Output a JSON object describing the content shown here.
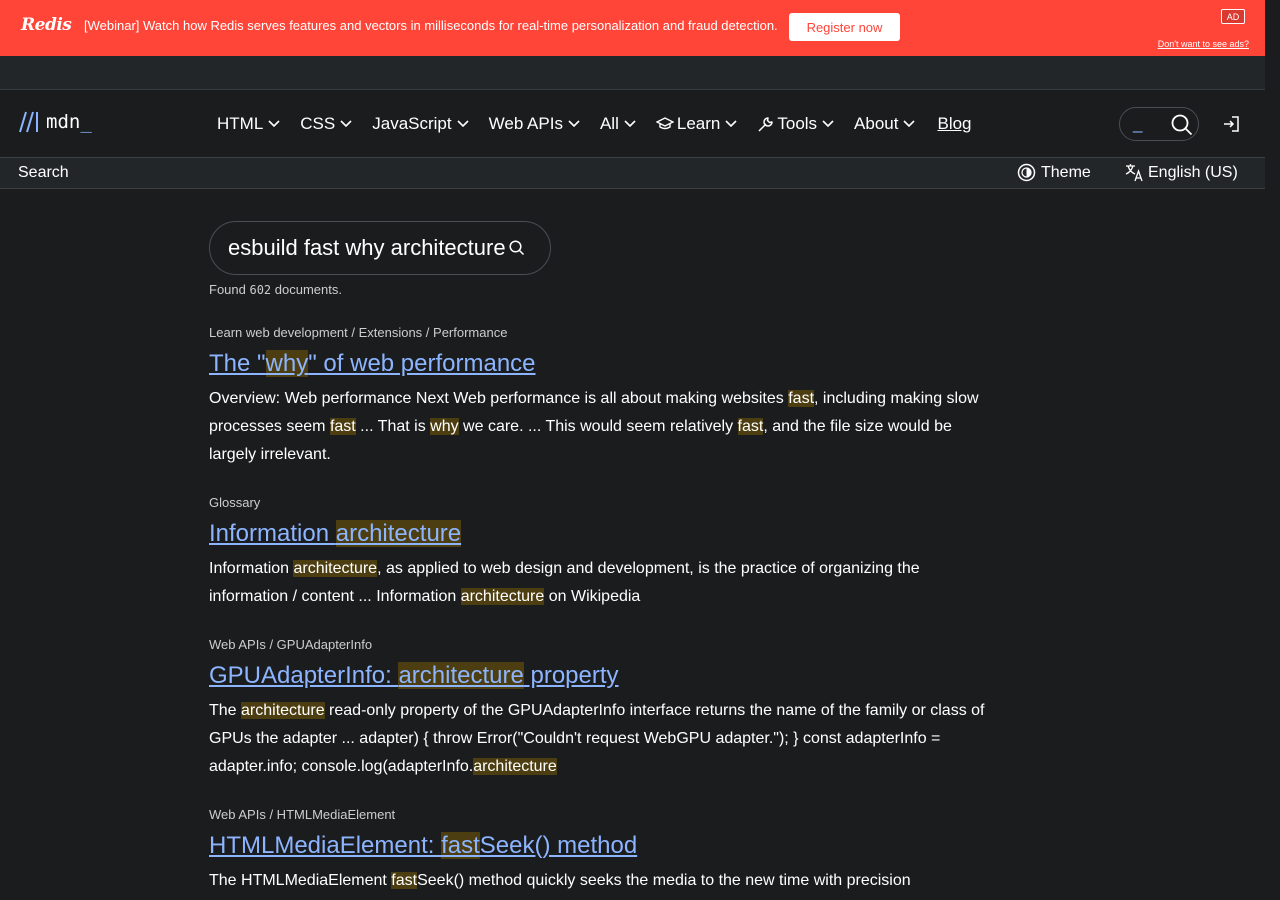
{
  "ad": {
    "logo": "Redis",
    "text": "[Webinar] Watch how Redis serves features and vectors in milliseconds for real-time personalization and fraud detection.",
    "cta": "Register now",
    "badge": "AD",
    "optout": "Don't want to see ads?"
  },
  "nav": {
    "logo_text": "mdn",
    "logo_cursor": "_",
    "items": [
      {
        "label": "HTML"
      },
      {
        "label": "CSS"
      },
      {
        "label": "JavaScript"
      },
      {
        "label": "Web APIs"
      },
      {
        "label": "All"
      },
      {
        "label": "Learn",
        "icon": "graduation-cap-icon"
      },
      {
        "label": "Tools",
        "icon": "wrench-icon"
      },
      {
        "label": "About"
      }
    ],
    "blog": "Blog",
    "search_cursor": "_"
  },
  "subbar": {
    "title": "Search",
    "theme": "Theme",
    "language": "English (US)"
  },
  "search": {
    "query": "esbuild fast why architecture",
    "found_prefix": "Found ",
    "found_count": "602",
    "found_suffix": " documents."
  },
  "results": [
    {
      "breadcrumb": "Learn web development / Extensions / Performance",
      "title": [
        [
          "The \"",
          false
        ],
        [
          "why",
          true
        ],
        [
          "\" of web performance",
          false
        ]
      ],
      "snippet": [
        [
          "Overview: Web performance Next Web performance is all about making websites ",
          false
        ],
        [
          "fast",
          true
        ],
        [
          ", including making slow processes seem ",
          false
        ],
        [
          "fast",
          true
        ],
        [
          " ... That is ",
          false
        ],
        [
          "why",
          true
        ],
        [
          " we care. ... This would seem relatively ",
          false
        ],
        [
          "fast",
          true
        ],
        [
          ", and the file size would be largely irrelevant.",
          false
        ]
      ]
    },
    {
      "breadcrumb": "Glossary",
      "title": [
        [
          "Information ",
          false
        ],
        [
          "architecture",
          true
        ]
      ],
      "snippet": [
        [
          "Information ",
          false
        ],
        [
          "architecture",
          true
        ],
        [
          ", as applied to web design and development, is the practice of organizing the information / content ... Information ",
          false
        ],
        [
          "architecture",
          true
        ],
        [
          " on Wikipedia",
          false
        ]
      ]
    },
    {
      "breadcrumb": "Web APIs / GPUAdapterInfo",
      "title": [
        [
          "GPUAdapterInfo: ",
          false
        ],
        [
          "architecture",
          true
        ],
        [
          " property",
          false
        ]
      ],
      "snippet": [
        [
          "The ",
          false
        ],
        [
          "architecture",
          true
        ],
        [
          " read-only property of the GPUAdapterInfo interface returns the name of the family or class of GPUs the adapter ... adapter) { throw Error(\"Couldn't request WebGPU adapter.\"); } const adapterInfo = adapter.info; console.log(adapterInfo.",
          false
        ],
        [
          "architecture",
          true
        ]
      ]
    },
    {
      "breadcrumb": "Web APIs / HTMLMediaElement",
      "title": [
        [
          "HTMLMediaElement: ",
          false
        ],
        [
          "fast",
          true
        ],
        [
          "Seek() method",
          false
        ]
      ],
      "snippet": [
        [
          "The HTMLMediaElement ",
          false
        ],
        [
          "fast",
          true
        ],
        [
          "Seek() method quickly seeks the media to the new time with precision",
          false
        ]
      ]
    }
  ],
  "colors": {
    "ad_bg": "#ff4438",
    "page_bg": "#1b1c1e",
    "link": "#8cb4ff",
    "highlight": "#4d3e11"
  }
}
